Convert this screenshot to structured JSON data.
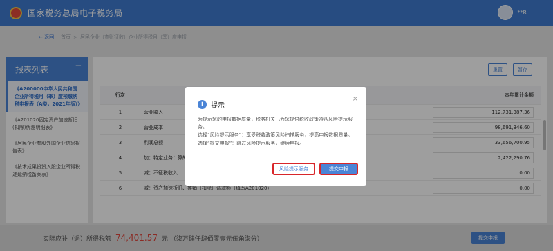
{
  "header": {
    "brand": "国家税务总局电子税务局",
    "user": "**R"
  },
  "breadcrumb": {
    "back": "← 返回",
    "home": "首页",
    "sep": ">",
    "current": "居民企业（查账征收）企业所得税月（季）度申报"
  },
  "sidebar": {
    "title": "报表列表",
    "items": [
      {
        "label": "《A200000中华人民共和国企业所得税月（季）度预缴纳税申报表（A类，2021年版）》",
        "active": true
      },
      {
        "label": "《A201020固定资产加速折旧(扣除)优惠明细表》",
        "active": false
      },
      {
        "label": "《居民企业参股外国企业信息报告表》",
        "active": false
      },
      {
        "label": "《技术成果投资入股企业所得税递延纳税备案表》",
        "active": false
      }
    ]
  },
  "toolbar": {
    "reset": "重置",
    "save": "暂存"
  },
  "table": {
    "headers": {
      "row": "行次",
      "item": "",
      "amount": "本年累计金额"
    },
    "rows": [
      {
        "no": "1",
        "item": "营业收入",
        "amount": "112,731,387.36"
      },
      {
        "no": "2",
        "item": "营业成本",
        "amount": "98,691,346.60"
      },
      {
        "no": "3",
        "item": "利润总额",
        "amount": "33,656,700.95"
      },
      {
        "no": "4",
        "item": "加：特定业务计算的应纳税所得额",
        "amount": "2,422,290.76"
      },
      {
        "no": "5",
        "item": "减：不征税收入",
        "amount": "0.00"
      },
      {
        "no": "6",
        "item": "减：资产加速折旧、摊销（扣除）调减额（填写A201020）",
        "amount": "0.00"
      }
    ]
  },
  "footer": {
    "label": "实际应补（退）所得税额",
    "amount": "74,401.57",
    "unit": "元",
    "words": "（柒万肆仟肆佰零壹元伍角柒分）",
    "submit": "提交申报"
  },
  "dialog": {
    "title": "提示",
    "lines": [
      "为提示您的申报数据质量，税务机关已为您提供税收政策遵从风险提示服务。",
      "选择“风险提示服务”：享受税收政策风险扫描服务，提高申报数据质量。",
      "选择“提交申报”：跳过风险提示服务，继续申报。"
    ],
    "risk_button": "风险提示服务",
    "submit_button": "提交申报",
    "close": "×"
  },
  "colors": {
    "header": "#3f7bd1",
    "primary": "#4a84d6",
    "highlight_border": "#d8262a",
    "amount": "#e0463c"
  }
}
